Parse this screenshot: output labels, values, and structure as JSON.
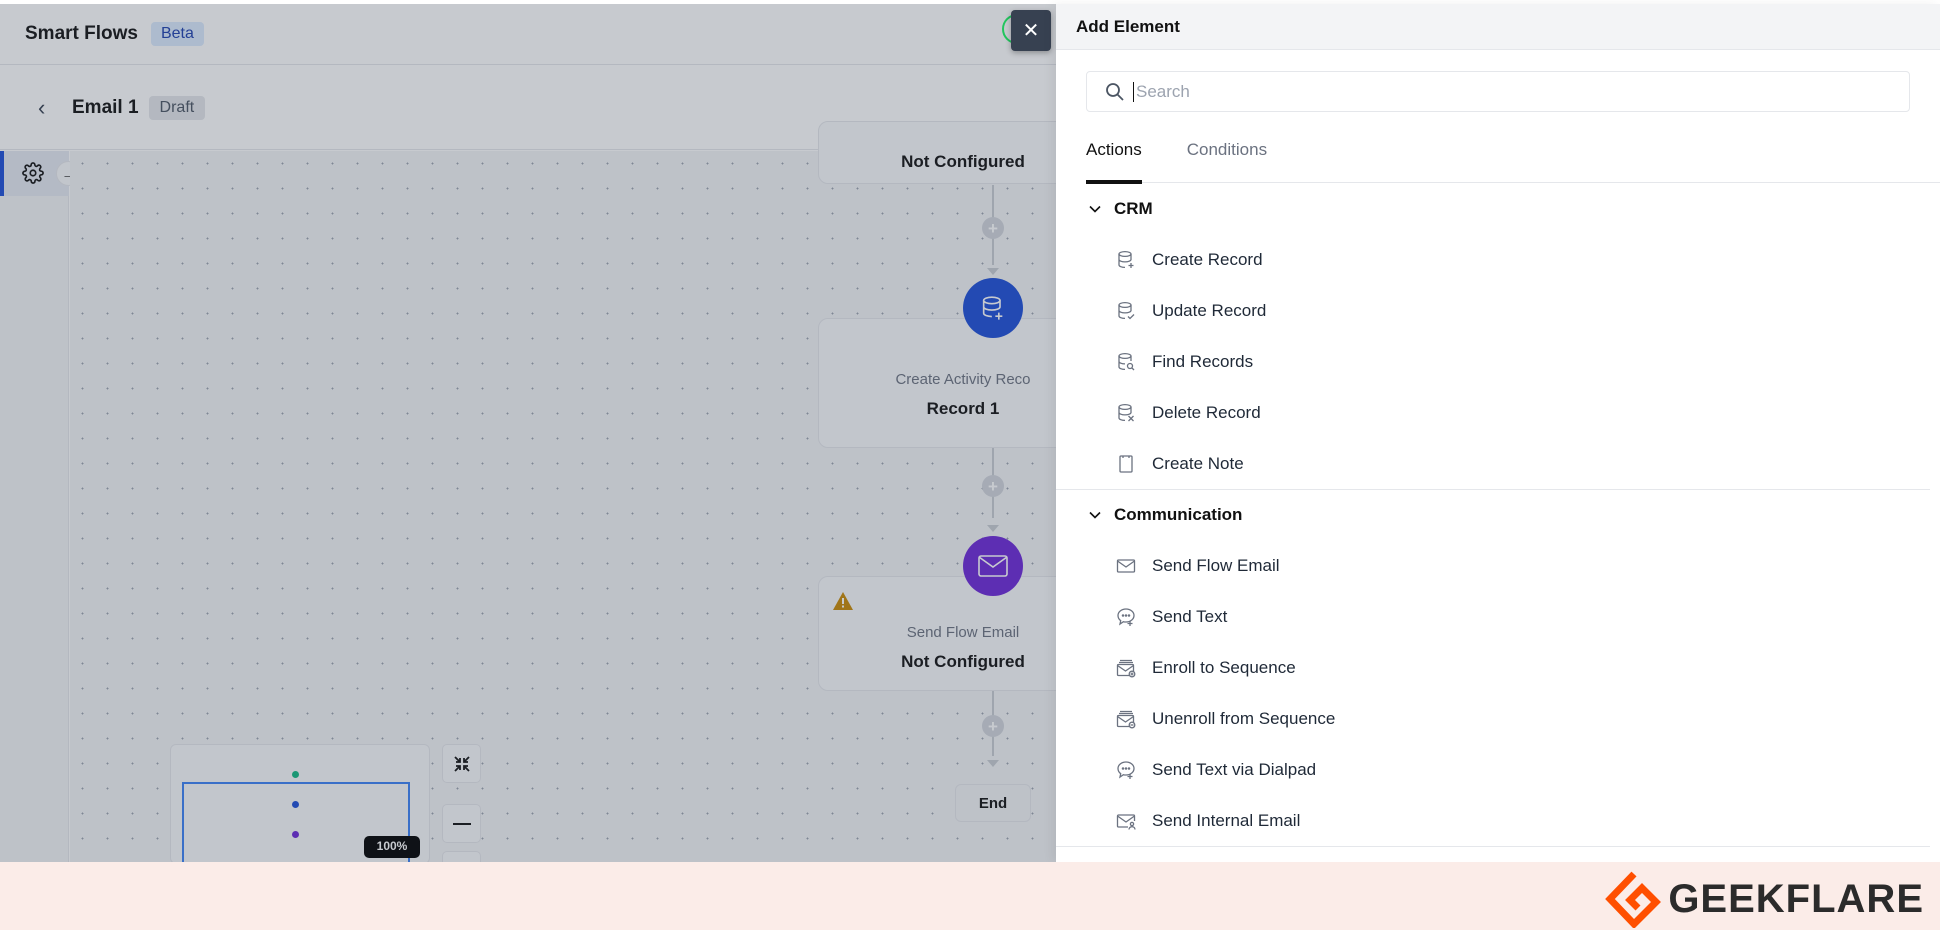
{
  "app": {
    "title": "Smart Flows",
    "title_badge": "Beta",
    "flow_name": "Email 1",
    "flow_status": "Draft"
  },
  "canvas": {
    "nodes": [
      {
        "label": "",
        "value": "Not Configured",
        "icon": "trigger-icon"
      },
      {
        "label": "Create Activity Reco",
        "value": "Record 1",
        "icon": "database-plus-icon",
        "color": "#1d4ed8"
      },
      {
        "label": "Send Flow Email",
        "value": "Not Configured",
        "icon": "mail-icon",
        "color": "#6d28d9",
        "warning": true
      }
    ],
    "end_label": "End",
    "zoom_level": "100%"
  },
  "panel": {
    "title": "Add Element",
    "search_placeholder": "Search",
    "search_value": "",
    "tabs": [
      {
        "label": "Actions",
        "active": true
      },
      {
        "label": "Conditions",
        "active": false
      }
    ],
    "sections": [
      {
        "title": "CRM",
        "items": [
          {
            "label": "Create Record",
            "icon": "database-plus-icon"
          },
          {
            "label": "Update Record",
            "icon": "database-check-icon"
          },
          {
            "label": "Find Records",
            "icon": "database-search-icon"
          },
          {
            "label": "Delete Record",
            "icon": "database-x-icon"
          },
          {
            "label": "Create Note",
            "icon": "note-icon"
          }
        ]
      },
      {
        "title": "Communication",
        "items": [
          {
            "label": "Send Flow Email",
            "icon": "mail-icon"
          },
          {
            "label": "Send Text",
            "icon": "chat-plus-icon"
          },
          {
            "label": "Enroll to Sequence",
            "icon": "mail-stack-plus-icon"
          },
          {
            "label": "Unenroll from Sequence",
            "icon": "mail-stack-minus-icon"
          },
          {
            "label": "Send Text via Dialpad",
            "icon": "chat-plus-icon"
          },
          {
            "label": "Send Internal Email",
            "icon": "mail-user-icon"
          }
        ]
      }
    ]
  },
  "watermark": {
    "text": "GEEKFLARE",
    "color": "#ff4f00"
  }
}
